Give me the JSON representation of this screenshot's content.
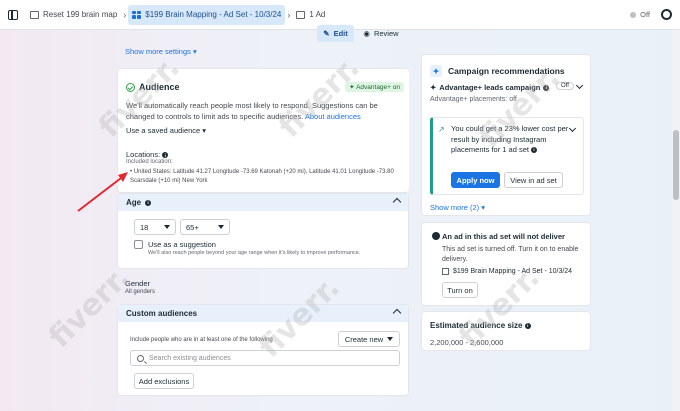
{
  "topbar": {
    "crumb_map": "Reset 199 brain map",
    "crumb_adset": "$199 Brain Mapping - Ad Set - 10/3/24",
    "crumb_ad": "1 Ad",
    "status": "Off"
  },
  "toolbar": {
    "edit": "Edit",
    "review": "Review"
  },
  "audience": {
    "show_more_settings": "Show more settings",
    "title": "Audience",
    "badge": "Advantage+ on",
    "description": "We'll automatically reach people most likely to respond. Suggestions can be changed to controls to limit ads to specific audiences.",
    "about_link": "About audiences",
    "saved_audience": "Use a saved audience",
    "locations_title": "Locations:",
    "locations_sub": "Included location:",
    "locations_text": "United States: Latitude 41.27 Longitude -73.69 Katonah (+20 mi), Latitude 41.01 Longitude -73.80 Scarsdale (+10 mi) New York"
  },
  "age": {
    "title": "Age",
    "min": "18",
    "max": "65+",
    "suggest": "Use as a suggestion",
    "note": "We'll also reach people beyond your age range when it's likely to improve performance."
  },
  "gender": {
    "title": "Gender",
    "value": "All genders"
  },
  "custom": {
    "title": "Custom audiences",
    "desc": "Include people who are in at least one of the following",
    "create_new": "Create new",
    "search_placeholder": "Search existing audiences",
    "add_exclusions": "Add exclusions"
  },
  "recommendations": {
    "title": "Campaign recommendations",
    "adv_leads": "Advantage+ leads campaign",
    "toggle": "Off",
    "placements": "Advantage+ placements: off",
    "suggestion": "You could get a 23% lower cost per result by including Instagram placements for 1 ad set",
    "apply": "Apply now",
    "view": "View in ad set",
    "show_more": "Show more (2)"
  },
  "delivery": {
    "title": "An ad in this ad set will not deliver",
    "desc": "This ad set is turned off. Turn it on to enable delivery.",
    "adset": "$199 Brain Mapping - Ad Set - 10/3/24",
    "turn_on": "Turn on"
  },
  "estimate": {
    "title": "Estimated audience size",
    "value": "2,200,000 - 2,600,000"
  },
  "watermark": "fiverr."
}
